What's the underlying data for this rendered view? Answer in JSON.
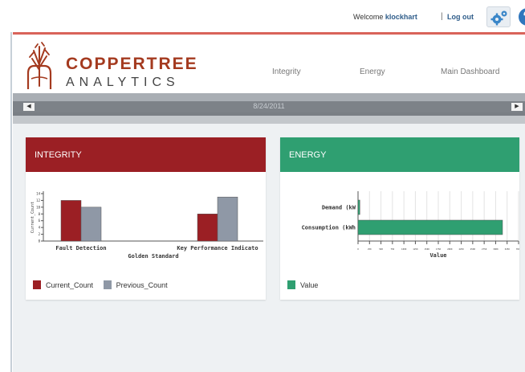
{
  "topbar": {
    "welcome_prefix": "Welcome",
    "username": "klockhart",
    "separator": "|",
    "logout_label": "Log out",
    "settings_icon": "gear-icon",
    "help_icon": "help-icon"
  },
  "logo": {
    "name": "COPPERTREE",
    "sub": "ANALYTICS",
    "icon": "tree-logo-icon"
  },
  "nav": {
    "items": [
      "Integrity",
      "Energy",
      "Main Dashboard"
    ]
  },
  "datebar": {
    "date": "8/24/2011",
    "prev_icon": "arrow-left-icon",
    "next_icon": "arrow-right-icon"
  },
  "panels": {
    "integrity": {
      "title": "INTEGRITY",
      "color": "#9b1f24"
    },
    "energy": {
      "title": "ENERGY",
      "color": "#2f9f71"
    }
  },
  "chart_data": [
    {
      "type": "bar",
      "categories": [
        "Fault Detection",
        "Key Performance Indicato"
      ],
      "series": [
        {
          "name": "Current_Count",
          "color": "#9b1f24",
          "values": [
            12,
            8
          ]
        },
        {
          "name": "Previous_Count",
          "color": "#8f98a6",
          "values": [
            10,
            13
          ]
        }
      ],
      "xlabel": "Golden Standard",
      "ylabel": "Current_Count",
      "ylim": [
        0,
        14
      ],
      "yticks": [
        0,
        2,
        4,
        6,
        8,
        10,
        12,
        14
      ],
      "legend": "bottom"
    },
    {
      "type": "bar",
      "orientation": "horizontal",
      "categories": [
        "Demand (kW",
        "Consumption (kWh"
      ],
      "series": [
        {
          "name": "Value",
          "color": "#2f9f71",
          "values": [
            40,
            3150
          ]
        }
      ],
      "xlabel": "Value",
      "xlim": [
        0,
        3500
      ],
      "xticks": [
        0,
        250,
        500,
        750,
        1000,
        1250,
        1500,
        1750,
        2000,
        2250,
        2500,
        2750,
        3000,
        3250,
        3500
      ],
      "legend": "bottom"
    }
  ]
}
